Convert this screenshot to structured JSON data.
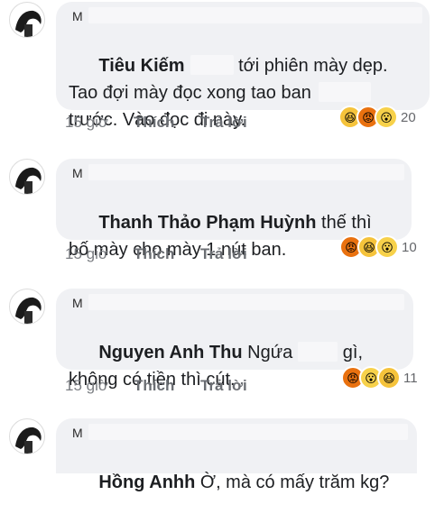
{
  "comments": [
    {
      "author": "M",
      "mention": "Tiêu Kiếm",
      "line1_after": " tới phiên mày dẹp.",
      "line2": "Tao đợi mày đọc xong tao ban",
      "line3": "trước. Vào đọc đi này.",
      "time": "15 giờ",
      "like": "Thích",
      "reply": "Trả lời",
      "reaction_icons": [
        "haha-icon",
        "angry-icon",
        "wow-icon"
      ],
      "reaction_count": "20"
    },
    {
      "author": "M",
      "mention": "Thanh Thảo Phạm Huỳnh",
      "line1_after": " thế thì",
      "line2": "bố mày cho mày 1 nút ban.",
      "time": "15 giờ",
      "like": "Thích",
      "reply": "Trả lời",
      "reaction_icons": [
        "angry-icon",
        "haha-icon",
        "wow-icon"
      ],
      "reaction_count": "10"
    },
    {
      "author": "M",
      "mention": "Nguyen Anh Thu",
      "line1_mid": " Ngứa",
      "line1_end": " gì,",
      "line2": "không có tiền thì cút.",
      "time": "15 giờ",
      "like": "Thích",
      "reply": "Trả lời",
      "reaction_icons": [
        "angry-icon",
        "wow-icon",
        "haha-icon"
      ],
      "reaction_count": "11"
    },
    {
      "author": "M",
      "mention": "Hồng Anhh",
      "line1_after": " Ờ, mà có mấy trăm kg?"
    }
  ],
  "colors": {
    "bubble": "#f0f1f4",
    "meta_text": "#7a7d82",
    "haha": "#f5c33b",
    "angry": "#e9710f",
    "wow": "#f7d14a"
  }
}
